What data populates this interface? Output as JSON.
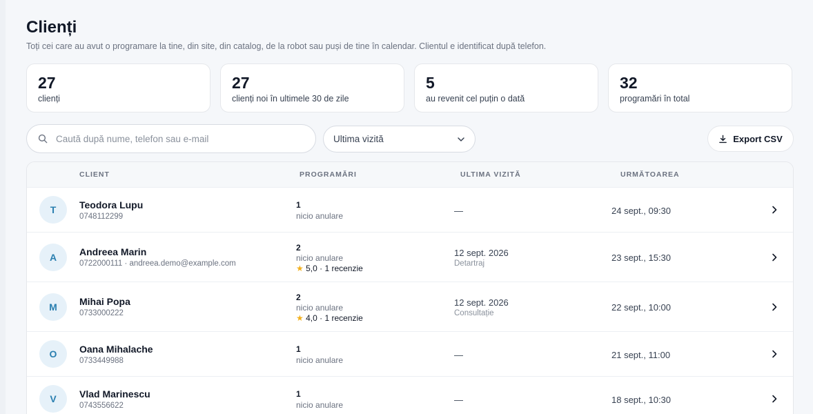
{
  "page": {
    "title": "Clienți",
    "subtitle": "Toți cei care au avut o programare la tine, din site, din catalog, de la robot sau puși de tine în calendar. Clientul e identificat după telefon."
  },
  "stats": [
    {
      "value": "27",
      "label": "clienți"
    },
    {
      "value": "27",
      "label": "clienți noi în ultimele 30 de zile"
    },
    {
      "value": "5",
      "label": "au revenit cel puțin o dată"
    },
    {
      "value": "32",
      "label": "programări în total"
    }
  ],
  "toolbar": {
    "search_placeholder": "Caută după nume, telefon sau e-mail",
    "sort_value": "Ultima vizită",
    "export_label": "Export CSV"
  },
  "table": {
    "headers": [
      "CLIENT",
      "PROGRAMĂRI",
      "ULTIMA VIZITĂ",
      "URMĂTOAREA"
    ],
    "rows": [
      {
        "initial": "T",
        "name": "Teodora Lupu",
        "contact": "0748112299",
        "count": "1",
        "cancellations": "nicio anulare",
        "review": "",
        "last_visit": "—",
        "service": "",
        "next": "24 sept., 09:30"
      },
      {
        "initial": "A",
        "name": "Andreea Marin",
        "contact": "0722000111 · andreea.demo@example.com",
        "count": "2",
        "cancellations": "nicio anulare",
        "review": "5,0 · 1 recenzie",
        "last_visit": "12 sept. 2026",
        "service": "Detartraj",
        "next": "23 sept., 15:30"
      },
      {
        "initial": "M",
        "name": "Mihai Popa",
        "contact": "0733000222",
        "count": "2",
        "cancellations": "nicio anulare",
        "review": "4,0 · 1 recenzie",
        "last_visit": "12 sept. 2026",
        "service": "Consultație",
        "next": "22 sept., 10:00"
      },
      {
        "initial": "O",
        "name": "Oana Mihalache",
        "contact": "0733449988",
        "count": "1",
        "cancellations": "nicio anulare",
        "review": "",
        "last_visit": "—",
        "service": "",
        "next": "21 sept., 11:00"
      },
      {
        "initial": "V",
        "name": "Vlad Marinescu",
        "contact": "0743556622",
        "count": "1",
        "cancellations": "nicio anulare",
        "review": "",
        "last_visit": "—",
        "service": "",
        "next": "18 sept., 10:30"
      }
    ]
  },
  "colors": {
    "accent": "#2a7fb0",
    "avatar_bg": "#e6f1f9",
    "star": "#f2b01e",
    "page_bg": "#f5f7fa"
  },
  "icons": {
    "search": "search-icon",
    "dropdown": "chevron-down-icon",
    "export": "download-icon",
    "row_open": "chevron-right-icon"
  }
}
